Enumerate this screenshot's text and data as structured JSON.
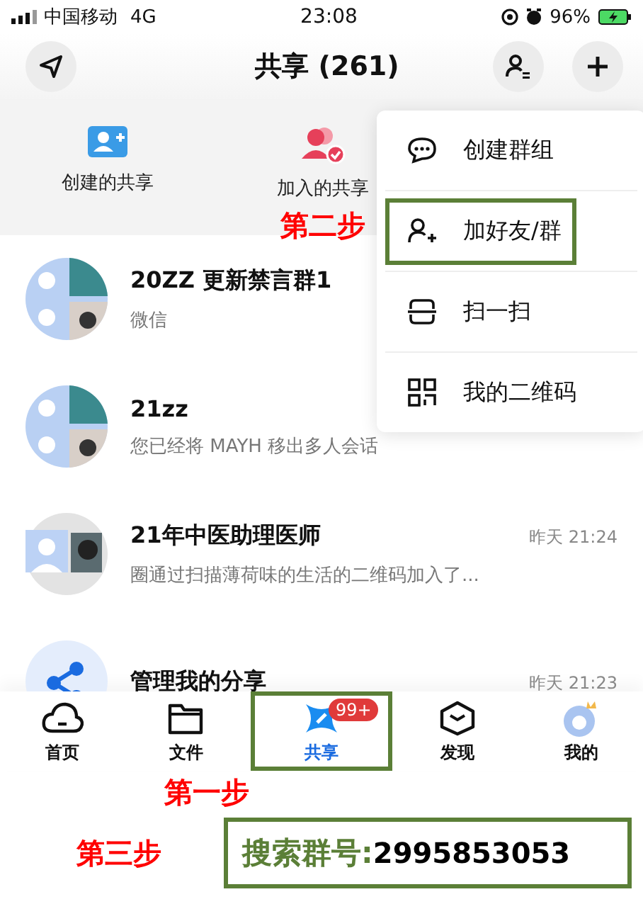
{
  "status_bar": {
    "carrier": "中国移动",
    "network": "4G",
    "time": "23:08",
    "battery": "96%"
  },
  "header": {
    "title": "共享 (261)"
  },
  "quick_actions": [
    {
      "label": "创建的共享",
      "kind": "create"
    },
    {
      "label": "加入的共享",
      "kind": "joined"
    }
  ],
  "conversations": [
    {
      "title": "20ZZ 更新禁言群1",
      "subtitle": "微信",
      "kind": "group"
    },
    {
      "title": "21zz",
      "subtitle": "您已经将 MAYH 移出多人会话",
      "kind": "group"
    },
    {
      "title": "21年中医助理医师",
      "subtitle": "圈通过扫描薄荷味的生活的二维码加入了...",
      "time": "昨天 21:24",
      "kind": "pair"
    },
    {
      "title": "管理我的分享",
      "time": "昨天 21:23",
      "kind": "share"
    }
  ],
  "popup_menu": {
    "items": [
      {
        "label": "创建群组",
        "kind": "chat",
        "highlighted": false
      },
      {
        "label": "加好友/群",
        "kind": "add-person",
        "highlighted": true
      },
      {
        "label": "扫一扫",
        "kind": "scan",
        "highlighted": false
      },
      {
        "label": "我的二维码",
        "kind": "qr",
        "highlighted": false
      }
    ]
  },
  "tab_bar": {
    "tabs": [
      {
        "label": "首页",
        "kind": "cloud",
        "selected": false,
        "highlighted": false
      },
      {
        "label": "文件",
        "kind": "folder",
        "selected": false,
        "highlighted": false
      },
      {
        "label": "共享",
        "kind": "share",
        "selected": true,
        "highlighted": true,
        "badge": "99+"
      },
      {
        "label": "发现",
        "kind": "cube",
        "selected": false,
        "highlighted": false
      },
      {
        "label": "我的",
        "kind": "me",
        "selected": false,
        "highlighted": false
      }
    ]
  },
  "annotations": {
    "step_one": "第一步",
    "step_two": "第二步",
    "step_three": "第三步",
    "search_label": "搜索群号:",
    "search_number": "2995853053"
  }
}
